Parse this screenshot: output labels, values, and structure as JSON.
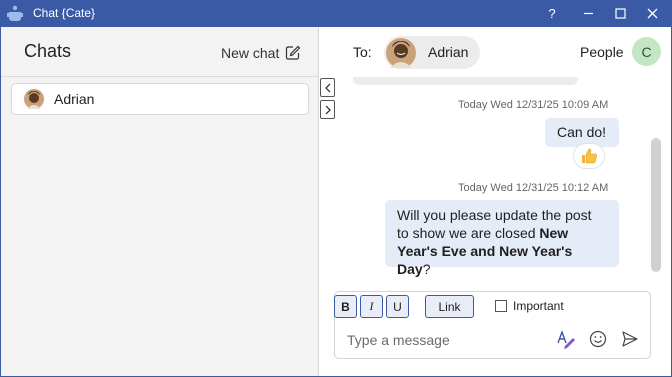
{
  "window": {
    "title": "Chat {Cate}",
    "help_label": "?",
    "minimize_label": "—",
    "close_label": "✕"
  },
  "sidebar": {
    "title": "Chats",
    "new_chat_label": "New chat",
    "chats": [
      {
        "name": "Adrian"
      }
    ]
  },
  "conversation": {
    "to_label": "To:",
    "recipient": "Adrian",
    "people_label": "People",
    "user_initial": "C",
    "messages": [
      {
        "timestamp": "Today Wed 12/31/25 10:09 AM",
        "text": "Can do!",
        "reaction": "thumbs-up"
      },
      {
        "timestamp": "Today Wed 12/31/25 10:12 AM",
        "text_before": "Will you please update the post to show we are closed ",
        "text_bold": "New Year's Eve and New Year's Day",
        "text_after": "?"
      }
    ]
  },
  "composer": {
    "bold_label": "B",
    "italic_label": "I",
    "underline_label": "U",
    "link_label": "Link",
    "important_label": "Important",
    "important_checked": false,
    "placeholder": "Type a message"
  },
  "colors": {
    "titlebar": "#3b5aa6",
    "bubble": "#e6ebf8",
    "sidebar_bg": "#f3f3f3",
    "avatar_bg": "#c5e6c5"
  }
}
